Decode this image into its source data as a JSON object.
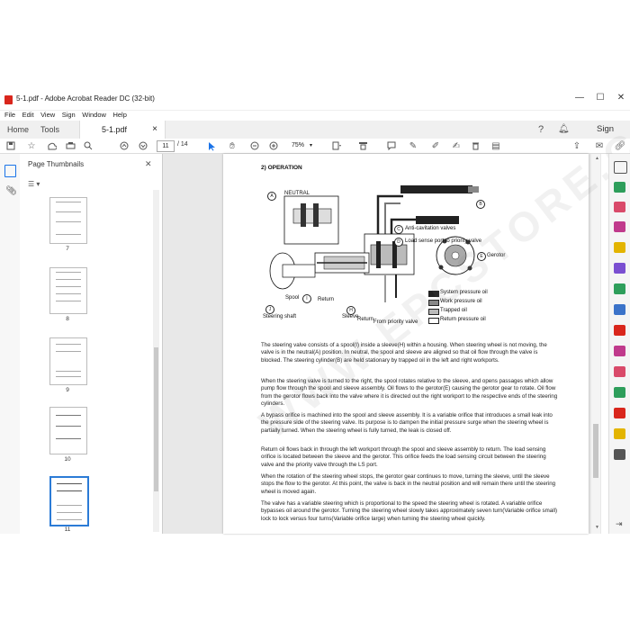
{
  "window": {
    "title": "5-1.pdf - Adobe Acrobat Reader DC (32-bit)",
    "minimize": "—",
    "maximize": "☐",
    "close": "✕"
  },
  "menu": [
    "File",
    "Edit",
    "View",
    "Sign",
    "Window",
    "Help"
  ],
  "tabs": {
    "home": "Home",
    "tools": "Tools",
    "doc": "5-1.pdf",
    "doc_close": "×",
    "signin": "Sign In"
  },
  "toolbar": {
    "page_current": "11",
    "page_total": "/ 14",
    "zoom": "75%"
  },
  "thumbnails": {
    "header": "Page Thumbnails",
    "close": "✕",
    "pages": [
      "7",
      "8",
      "9",
      "10",
      "11"
    ]
  },
  "document": {
    "heading": "2) OPERATION",
    "diagram": {
      "neutral": "NEUTRAL",
      "anti_cavitation": "Anti-cavitation valves",
      "load_sense": "Load sense port to priority valve",
      "gerotor": "Gerotor",
      "spool": "Spool",
      "return": "Return",
      "steering_shaft": "Steering shaft",
      "sleeve": "Sleeve",
      "return2": "Return",
      "from_priority": "From priority valve",
      "markers": [
        "A",
        "B",
        "C",
        "D",
        "E",
        "I",
        "J",
        "H"
      ],
      "legend": [
        "System pressure oil",
        "Work pressure oil",
        "Trapped oil",
        "Return pressure oil"
      ]
    },
    "paragraphs": [
      "The steering valve consists of a spool(I) inside a sleeve(H) within a housing.  When steering wheel is not moving, the valve is in the neutral(A) position.  In neutral, the spool and sleeve are aligned so that oil flow through the valve is blocked.  The steering cylinder(B) are held stationary by trapped oil in the left and right workports.",
      "When the steering valve is turned to the right, the spool rotates relative to the sleeve, and opens passages which allow pump flow through the spool and sleeve assembly.  Oil flows to the gerotor(E) causing the gerotor gear to rotate.  Oil flow from the gerotor flows back into the valve where it is directed out the right workport to the respective ends of the steering cylinders.",
      "A bypass orifice is machined into the spool and sleeve assembly.  It is a variable orifice that introduces a small leak into the pressure side of the steering valve.  Its purpose is to dampen the initial pressure surge when the steering wheel is partially turned.  When the steering wheel is fully turned, the leak is closed off.",
      "Return oil flows back in through the left workport through the spool and sleeve assembly to return.  The load sensing orifice is located between the sleeve and the gerotor.  This orifice feeds the load sensing circuit between the steering valve and the priority valve through the LS port.",
      "When the rotation of the steering wheel stops, the gerotor gear continues to move, turning the sleeve, until the sleeve stops the flow to the gerotor.  At this point, the valve is back in the neutral position and will remain there until the steering wheel is moved again.",
      "The valve has a variable steering which is proportional to the speed the steering wheel is rotated.  A variable orifice bypasses oil around the gerotor.  Turning the steering wheel slowly takes approximately seven turn(Variable orifice small) lock to lock versus four turns(Variable orifice large) when turning the steering wheel quickly."
    ],
    "watermark": "WWW.EPCSTORE.COM"
  }
}
